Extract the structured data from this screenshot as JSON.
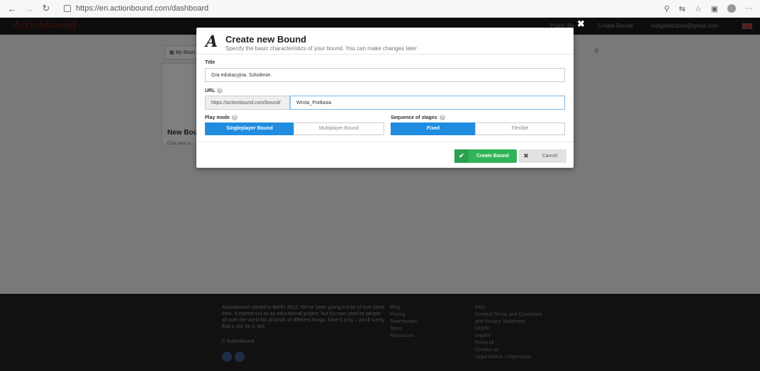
{
  "browser": {
    "url": "https://en.actionbound.com/dashboard"
  },
  "app": {
    "logo": "Actionbound",
    "header": {
      "public": "Public Bo",
      "create": "Create Bound",
      "email": "mdigitalization@gmail.com"
    },
    "my_bounds_tab": "My Boun",
    "new_bound_title": "New Bou",
    "new_bound_sub": "Click here to",
    "footer": {
      "about": "Actionbound started in Berlin 2012. We've been giving it a lot of love since then. It started out as an educational project, but it's now used by people all over the world for all kinds of different things. Give it a try – you'll surely find a use for it, too.",
      "copyright": "© Actionbound",
      "col1": [
        "Blog",
        "Pricing",
        "Testimonials",
        "Store",
        "Resources"
      ],
      "col2": [
        "FAQ",
        "General Terms and Conditions",
        "and Privacy Statement",
        "GDPR",
        "Imprint",
        "Press kit",
        "Contact us",
        "Legal Notice / Impressum"
      ]
    }
  },
  "modal": {
    "logo_glyph": "A",
    "title": "Create new Bound",
    "subtitle": "Specify the basic characteristics of your bound. You can make changes later",
    "title_label": "Title",
    "title_value": "Gra edukacyjna. Szkolenie.",
    "url_label": "URL",
    "url_prefix": "https://actionbound.com/bound/",
    "url_value": "Wrota_Podlasia",
    "play_mode_label": "Play mode",
    "play_modes": [
      "Singleplayer Bound",
      "Multiplayer Bound"
    ],
    "sequence_label": "Sequence of stages",
    "sequences": [
      "Fixed",
      "Flexible"
    ],
    "create_label": "Create Bound",
    "cancel_label": "Cancel"
  },
  "colors": {
    "primary": "#1f8ce0",
    "success": "#2fb457",
    "overlay": "rgba(0,0,0,0.5)"
  }
}
